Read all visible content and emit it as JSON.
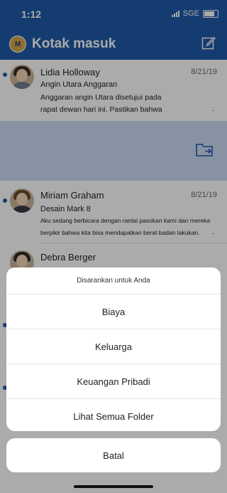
{
  "status_bar": {
    "time": "1:12",
    "carrier": "SGE"
  },
  "header": {
    "avatar_initial": "M",
    "title": "Kotak masuk"
  },
  "emails": [
    {
      "sender": "Lidia Holloway",
      "date": "8/21/19",
      "subject": "Angin Utara Anggaran",
      "preview_line1": "Anggaran angin Utara disetujui pada",
      "preview_line2": "rapat dewan hari ini. Pastikan bahwa",
      "trailing_mark": "."
    },
    {
      "sender": "Miriam Graham",
      "date": "8/21/19",
      "subject": "Desain Mark 8",
      "preview_line1": "Aku sedang berbicara dengan rantai pasokan kami dan mereka",
      "preview_line2": "berpikir bahwa kita bisa mendapatkan berat badan lakukan.",
      "trailing_mark": "."
    },
    {
      "sender": "Debra Berger"
    }
  ],
  "action_sheet": {
    "title": "Disarankan untuk Anda",
    "options": [
      "Biaya",
      "Keluarga",
      "Keuangan Pribadi",
      "Lihat Semua Folder"
    ],
    "cancel_label": "Batal"
  },
  "colors": {
    "accent": "#1f5aa8",
    "swipe_highlight": "#c9dbf3"
  }
}
